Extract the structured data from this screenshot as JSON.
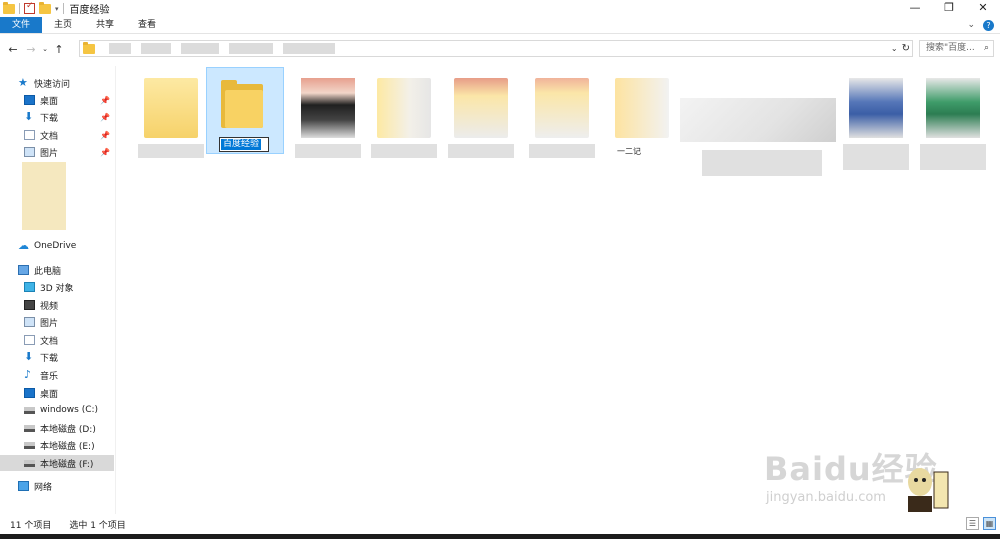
{
  "window": {
    "title": "百度经验"
  },
  "ribbon": {
    "tabs": [
      "文件",
      "主页",
      "共享",
      "查看"
    ]
  },
  "search": {
    "placeholder": "搜索\"百度..."
  },
  "sidebar": {
    "quick_access": "快速访问",
    "quick_items": [
      "桌面",
      "下载",
      "文档",
      "图片"
    ],
    "onedrive": "OneDrive",
    "this_pc": "此电脑",
    "pc_items": [
      "3D 对象",
      "视频",
      "图片",
      "文档",
      "下载",
      "音乐",
      "桌面",
      "windows (C:)",
      "本地磁盘 (D:)",
      "本地磁盘 (E:)",
      "本地磁盘 (F:)"
    ],
    "network": "网络"
  },
  "content": {
    "rename_value": "百度经验",
    "partial_label": "一二记"
  },
  "status": {
    "item_count": "11 个项目",
    "selected": "选中 1 个项目"
  },
  "watermark": {
    "brand": "Baidu经验",
    "url": "jingyan.baidu.com"
  },
  "colors": {
    "accent": "#1979ca",
    "selection": "#cce8ff",
    "folder": "#f8d263"
  }
}
